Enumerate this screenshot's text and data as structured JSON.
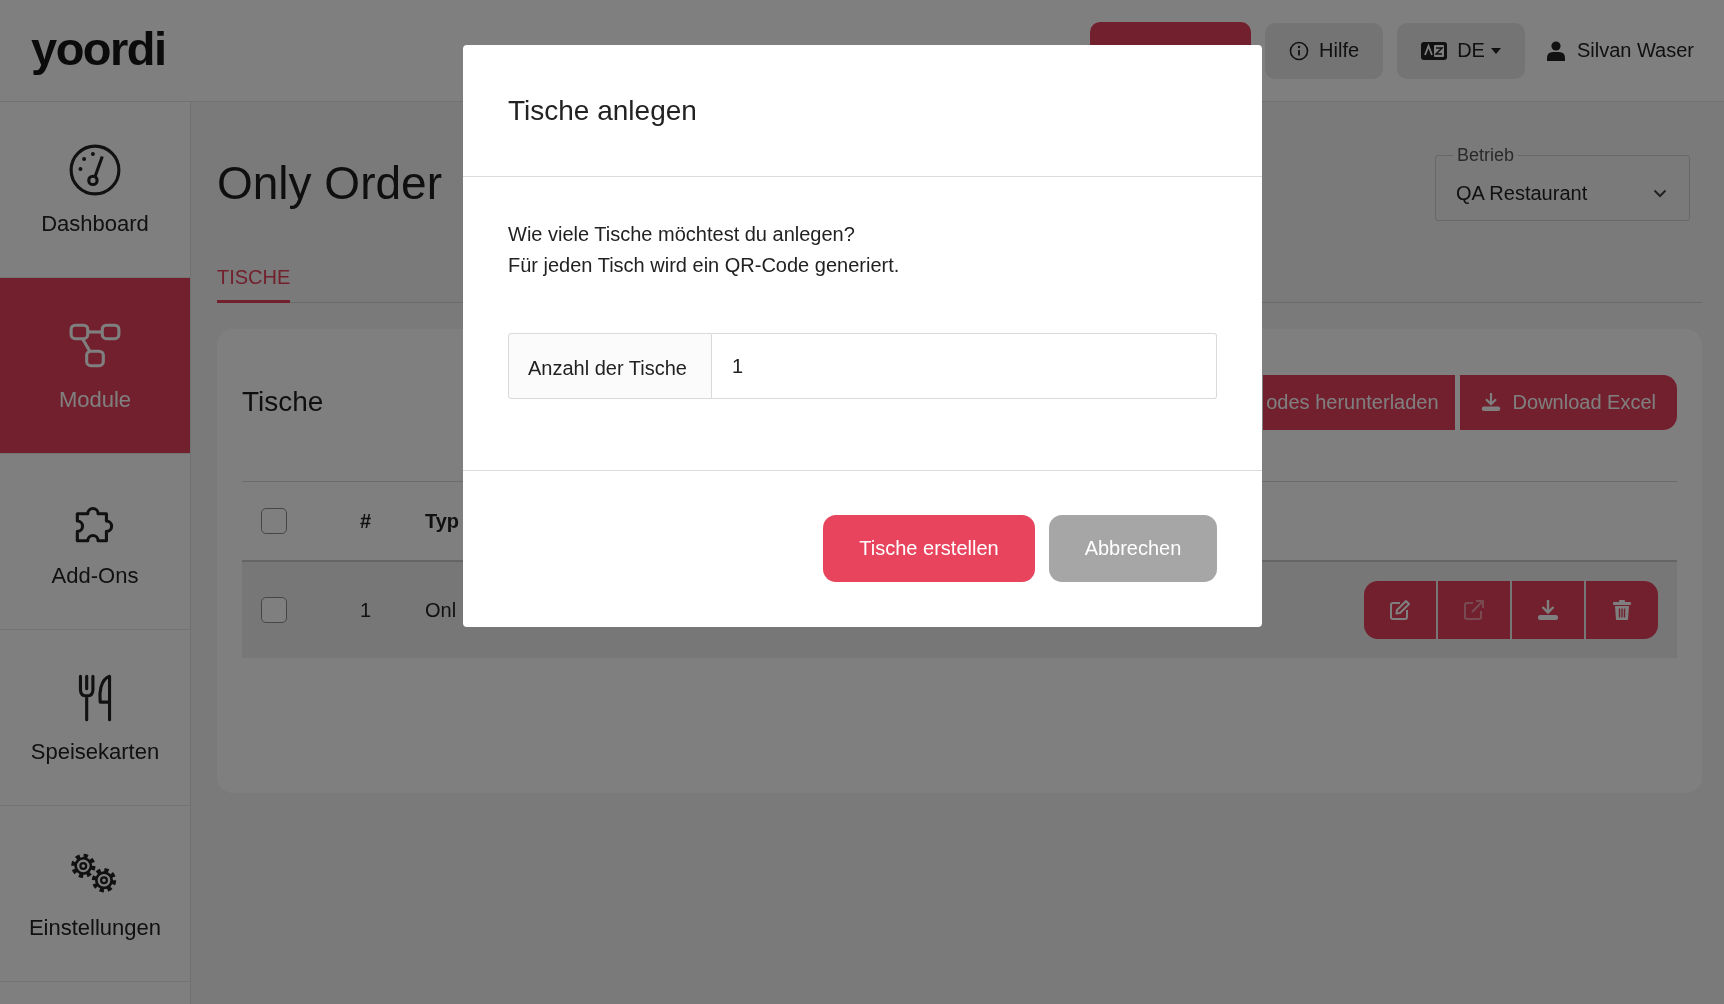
{
  "header": {
    "logo": "yoordi",
    "actions": [
      {
        "kind": "accent"
      },
      {
        "kind": "help",
        "label": "Hilfe"
      },
      {
        "kind": "language",
        "label": "DE"
      }
    ],
    "user": "Silvan Waser"
  },
  "sidebar": {
    "items": [
      {
        "kind": "dashboard",
        "label": "Dashboard",
        "selected": false
      },
      {
        "kind": "modules",
        "label": "Module",
        "selected": true
      },
      {
        "kind": "addons",
        "label": "Add-Ons",
        "selected": false
      },
      {
        "kind": "menus",
        "label": "Speisekarten",
        "selected": false
      },
      {
        "kind": "settings",
        "label": "Einstellungen",
        "selected": false
      }
    ]
  },
  "page": {
    "title": "Only Order",
    "business_select": {
      "label": "Betrieb",
      "value": "QA Restaurant"
    },
    "tabs": [
      {
        "label": "TISCHE",
        "selected": true
      }
    ]
  },
  "card": {
    "title": "Tische",
    "buttons": [
      {
        "kind": "qr",
        "label": "odes herunterladen"
      },
      {
        "kind": "excel",
        "label": "Download Excel"
      }
    ],
    "table": {
      "select_all": false,
      "columns": [
        "#",
        "Typ"
      ],
      "rows": [
        {
          "checked": false,
          "number": "1",
          "type": "Onl",
          "actions": [
            {
              "kind": "edit",
              "disabled": false
            },
            {
              "kind": "open",
              "disabled": true
            },
            {
              "kind": "download",
              "disabled": false
            },
            {
              "kind": "delete",
              "disabled": false
            }
          ]
        }
      ]
    }
  },
  "modal": {
    "title": "Tische anlegen",
    "message": [
      "Wie viele Tische möchtest du anlegen?",
      "Für jeden Tisch wird ein QR-Code generiert."
    ],
    "field": {
      "label": "Anzahl der Tische",
      "value": "1"
    },
    "buttons": [
      {
        "kind": "primary",
        "label": "Tische erstellen"
      },
      {
        "kind": "secondary",
        "label": "Abbrechen"
      }
    ]
  }
}
